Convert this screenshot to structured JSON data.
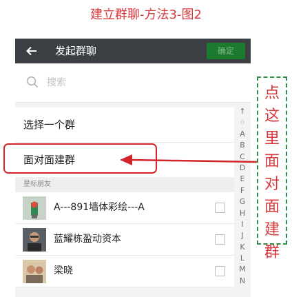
{
  "caption": "建立群聊-方法3-图2",
  "topbar": {
    "title": "发起群聊",
    "confirm_label": "确定"
  },
  "search": {
    "placeholder": "搜索"
  },
  "options": {
    "select_group": "选择一个群",
    "face_to_face": "面对面建群"
  },
  "section_title": "星标朋友",
  "contacts": [
    {
      "name": "A---891墙体彩绘---A"
    },
    {
      "name": "蓝耀栋盈动资本"
    },
    {
      "name": "梁晓"
    }
  ],
  "index_letters": [
    "↑",
    "☆",
    "A",
    "B",
    "C",
    "D",
    "E",
    "F",
    "G",
    "H",
    "I",
    "J",
    "K",
    "L",
    "M",
    "N"
  ],
  "annotation": {
    "text": "点这里面对面建群"
  },
  "colors": {
    "topbar": "#3b3e43",
    "confirm_button": "#1c7a2e",
    "highlight": "#d3242a",
    "annotation_text": "#d8383c",
    "annotation_border": "#2b8f45"
  }
}
